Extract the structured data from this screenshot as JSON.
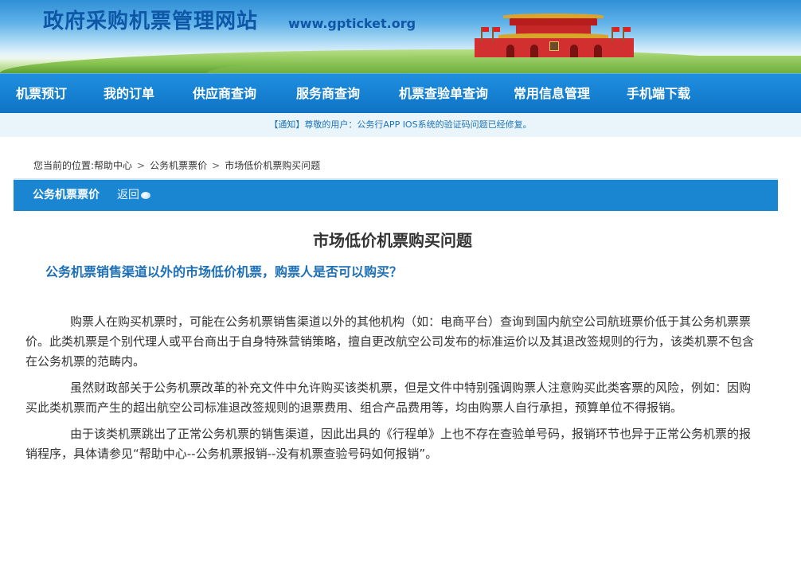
{
  "header": {
    "site_title": "政府采购机票管理网站",
    "site_url": "www.gpticket.org"
  },
  "nav": {
    "items": [
      {
        "label": "机票预订"
      },
      {
        "label": "我的订单"
      },
      {
        "label": "供应商查询"
      },
      {
        "label": "服务商查询"
      },
      {
        "label": "机票查验单查询"
      },
      {
        "label": "常用信息管理"
      },
      {
        "label": "手机端下载"
      }
    ]
  },
  "notice": {
    "text": "【通知】尊敬的用户：公务行APP IOS系统的验证码问题已经修复。"
  },
  "breadcrumb": {
    "prefix": "您当前的位置:帮助中心",
    "sep": ">",
    "level1": "公务机票票价",
    "level2": "市场低价机票购买问题"
  },
  "section": {
    "title": "公务机票票价",
    "back_label": "返回"
  },
  "article": {
    "title": "市场低价机票购买问题",
    "question": "公务机票销售渠道以外的市场低价机票，购票人是否可以购买？",
    "paragraphs": [
      "购票人在购买机票时，可能在公务机票销售渠道以外的其他机构（如：电商平台）查询到国内航空公司航班票价低于其公务机票票价。此类机票是个别代理人或平台商出于自身特殊营销策略，擅自更改航空公司发布的标准运价以及其退改签规则的行为，该类机票不包含在公务机票的范畴内。",
      "虽然财政部关于公务机票改革的补充文件中允许购买该类机票，但是文件中特别强调购票人注意购买此类客票的风险，例如：因购买此类机票而产生的超出航空公司标准退改签规则的退票费用、组合产品费用等，均由购票人自行承担，预算单位不得报销。",
      "由于该类机票跳出了正常公务机票的销售渠道，因此出具的《行程单》上也不存在查验单号码，报销环节也异于正常公务机票的报销程序，具体请参见“帮助中心--公务机票报销--没有机票查验号码如何报销”。"
    ]
  },
  "colors": {
    "nav_bg": "#1a86d2",
    "title_blue": "#0e57a7",
    "question_blue": "#1d6fb5",
    "notice_bg": "#eaf5fb"
  }
}
